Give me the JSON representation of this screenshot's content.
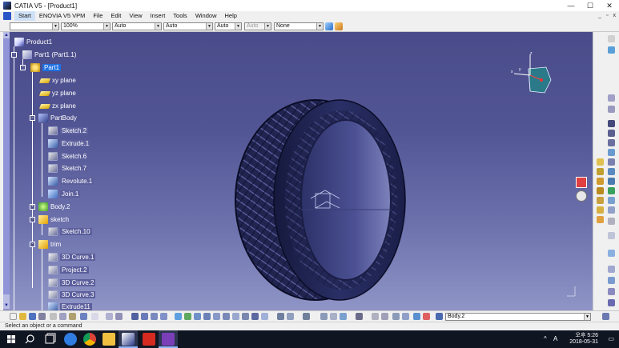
{
  "window": {
    "title": "CATIA V5 - [Product1]",
    "controls": {
      "minimize": "—",
      "maximize": "☐",
      "close": "✕"
    }
  },
  "menubar": {
    "items": [
      "Start",
      "ENOVIA V5 VPM",
      "File",
      "Edit",
      "View",
      "Insert",
      "Tools",
      "Window",
      "Help"
    ],
    "mdi": {
      "minimize": "_",
      "restore": "▫",
      "close": "x"
    }
  },
  "toolbar": {
    "combos": [
      {
        "value": ""
      },
      {
        "value": "100%"
      },
      {
        "value": "Auto"
      },
      {
        "value": "Auto"
      },
      {
        "value": "Auto"
      },
      {
        "value": "Auto"
      },
      {
        "value": "None"
      }
    ]
  },
  "tree": {
    "nodes": [
      {
        "label": "Product1",
        "icon": "product-icon"
      },
      {
        "label": "Part1 (Part1.1)",
        "icon": "part-icon"
      },
      {
        "label": "Part1",
        "icon": "gear-icon",
        "selected": true
      },
      {
        "label": "xy plane",
        "icon": "plane-icon"
      },
      {
        "label": "yz plane",
        "icon": "plane-icon"
      },
      {
        "label": "zx plane",
        "icon": "plane-icon"
      },
      {
        "label": "PartBody",
        "icon": "partbody-icon"
      },
      {
        "label": "Sketch.2",
        "icon": "sketch-icon"
      },
      {
        "label": "Extrude.1",
        "icon": "extrude-icon"
      },
      {
        "label": "Sketch.6",
        "icon": "sketch-icon"
      },
      {
        "label": "Sketch.7",
        "icon": "sketch-icon"
      },
      {
        "label": "Revolute.1",
        "icon": "revolute-icon"
      },
      {
        "label": "Join.1",
        "icon": "join-icon"
      },
      {
        "label": "Body.2",
        "icon": "body-icon"
      },
      {
        "label": "sketch",
        "icon": "geometrical-set-icon"
      },
      {
        "label": "Sketch.10",
        "icon": "sketch-icon"
      },
      {
        "label": "trim",
        "icon": "geometrical-set-icon"
      },
      {
        "label": "3D Curve.1",
        "icon": "curve-icon"
      },
      {
        "label": "Project.2",
        "icon": "project-icon"
      },
      {
        "label": "3D Curve.2",
        "icon": "curve-icon"
      },
      {
        "label": "3D Curve.3",
        "icon": "curve-icon"
      },
      {
        "label": "Extrude11",
        "icon": "extrude-icon"
      }
    ]
  },
  "compass": {
    "x": "x",
    "y": "y",
    "z": "z"
  },
  "bottom_toolbar": {
    "current_body": "Body.2"
  },
  "status": {
    "text": "Select an object or a command"
  },
  "taskbar": {
    "time": "오후 5:26",
    "date": "2018-05-31",
    "ime": "A"
  },
  "colors": {
    "viewport_top": "#4a4c8a",
    "viewport_bottom": "#8f95c6",
    "selection": "#1d6fe0",
    "tire": "#1f2450"
  }
}
